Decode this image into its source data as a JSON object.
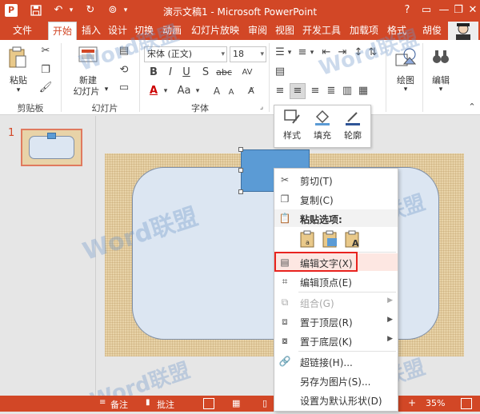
{
  "window": {
    "title": "演示文稿1 - Microsoft PowerPoint",
    "app_icon": "P",
    "help": "?",
    "minimize": "—",
    "restore": "❐",
    "close": "✕"
  },
  "quick_access": [
    "save-icon",
    "undo-icon",
    "redo-icon",
    "start-from-beginning-icon"
  ],
  "tabs": [
    {
      "label": "文件",
      "name": "tab-file"
    },
    {
      "label": "开始",
      "name": "tab-home"
    },
    {
      "label": "插入",
      "name": "tab-insert"
    },
    {
      "label": "设计",
      "name": "tab-design"
    },
    {
      "label": "切换",
      "name": "tab-transitions"
    },
    {
      "label": "动画",
      "name": "tab-animations"
    },
    {
      "label": "幻灯片放映",
      "name": "tab-slideshow"
    },
    {
      "label": "审阅",
      "name": "tab-review"
    },
    {
      "label": "视图",
      "name": "tab-view"
    },
    {
      "label": "开发工具",
      "name": "tab-developer"
    },
    {
      "label": "加载项",
      "name": "tab-addins"
    },
    {
      "label": "格式",
      "name": "tab-format"
    }
  ],
  "active_tab": "开始",
  "user": {
    "name": "胡俊"
  },
  "ribbon": {
    "clipboard": {
      "paste": "粘贴",
      "group": "剪贴板"
    },
    "slides": {
      "new_slide_line1": "新建",
      "new_slide_line2": "幻灯片",
      "group": "幻灯片"
    },
    "font": {
      "family": "宋体 (正文)",
      "size": "18",
      "group": "字体",
      "bold": "B",
      "italic": "I",
      "underline": "U",
      "shadow": "S",
      "strike": "abc",
      "spacing": "AV",
      "font_color": "A",
      "change_case": "Aa"
    },
    "paragraph": {
      "group": "段落"
    },
    "drawing": {
      "label": "绘图"
    },
    "editing": {
      "label": "编辑"
    }
  },
  "thumbnail": {
    "number": "1"
  },
  "mini_toolbar": {
    "style": "样式",
    "fill": "填充",
    "outline": "轮廓"
  },
  "context_menu": {
    "items": [
      {
        "label": "剪切(T)",
        "icon": "cut-icon",
        "disabled": false,
        "submenu": false
      },
      {
        "label": "复制(C)",
        "icon": "copy-icon",
        "disabled": false,
        "submenu": false
      },
      {
        "label": "粘贴选项:",
        "icon": "paste-icon",
        "disabled": false,
        "submenu": false,
        "header": true
      },
      {
        "label": "编辑文字(X)",
        "icon": "edit-text-icon",
        "disabled": false,
        "submenu": false,
        "highlighted": true
      },
      {
        "label": "编辑顶点(E)",
        "icon": "edit-points-icon",
        "disabled": false,
        "submenu": false
      },
      {
        "label": "组合(G)",
        "icon": "group-icon",
        "disabled": true,
        "submenu": true
      },
      {
        "label": "置于顶层(R)",
        "icon": "bring-to-front-icon",
        "disabled": false,
        "submenu": true
      },
      {
        "label": "置于底层(K)",
        "icon": "send-to-back-icon",
        "disabled": false,
        "submenu": true
      },
      {
        "label": "超链接(H)...",
        "icon": "hyperlink-icon",
        "disabled": false,
        "submenu": false
      },
      {
        "label": "另存为图片(S)...",
        "icon": "",
        "disabled": false,
        "submenu": false
      },
      {
        "label": "设置为默认形状(D)",
        "icon": "",
        "disabled": false,
        "submenu": false
      }
    ]
  },
  "statusbar": {
    "notes": "备注",
    "comments": "批注",
    "zoom_plus": "+",
    "zoom": "35%"
  },
  "watermark": {
    "word": "Word",
    "cn": "联盟"
  },
  "colors": {
    "accent": "#d24726",
    "shape_fill": "#dce6f2",
    "shape_border": "#7f8fa6",
    "small_rect_fill": "#5b9bd5",
    "highlight_border": "#e8231f",
    "slide_bg": "#e8d3a8"
  }
}
